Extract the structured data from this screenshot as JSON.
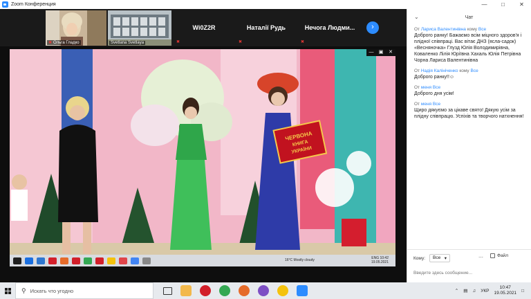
{
  "window": {
    "title": "Zoom Конференция"
  },
  "participants": [
    {
      "name": "Ольга Гладко",
      "type": "video"
    },
    {
      "name": "Svetlana Svetlaya",
      "type": "video"
    },
    {
      "name": "Wi0Z2R",
      "type": "text"
    },
    {
      "name": "Наталії Рудь",
      "type": "text"
    },
    {
      "name": "Нечога Людми...",
      "type": "text"
    }
  ],
  "video": {
    "inner_weather": "16°C Mostly cloudy",
    "inner_time": "10:42",
    "inner_date": "19.05.2021",
    "inner_lang": "ENG"
  },
  "chat": {
    "title": "Чат",
    "messages": [
      {
        "from_label": "От",
        "from": "Лариса Валентинівна",
        "to_label": "кому",
        "to": "Все",
        "text": "Доброго ранку! Бажаємо всім міцного здоров'я і плідної співпраці. Вас вітає ДНЗ (ясла-садок) «Весняночка» Глузд Юлія Володимирівна, Коваленко Лілія Юріївна Хахаль Юлія Петрівна Чорна Лариса Валентинівна"
      },
      {
        "from_label": "От",
        "from": "Надія Калініченко",
        "to_label": "кому",
        "to": "Все",
        "text": "Доброго ранку!!☺"
      },
      {
        "from_label": "От",
        "from": "меня",
        "to_label": "",
        "to": "Все",
        "text": "Доброго дня усім!"
      },
      {
        "from_label": "От",
        "from": "меня",
        "to_label": "",
        "to": "Все",
        "text": "Щиро дякуємо за цікаве свято! Дякую усім за плідну співпрацю. Успіхів та творчого натхнення!"
      }
    ],
    "to_label": "Кому:",
    "to_value": "Все",
    "file_label": "Файл",
    "input_placeholder": "Введите здесь сообщение..."
  },
  "taskbar": {
    "search_placeholder": "Искать что угодно",
    "lang": "УКР",
    "time": "10:47",
    "date": "19.05.2021"
  },
  "colors": {
    "accent": "#2d8cff",
    "muted_red": "#e53935"
  }
}
